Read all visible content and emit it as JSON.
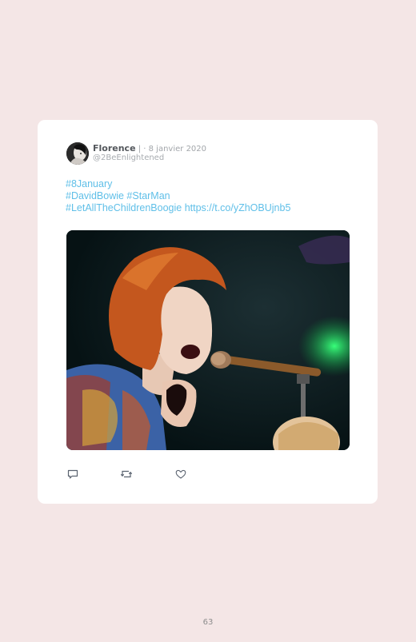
{
  "tweet": {
    "author_name": "Florence",
    "author_separator": " | ",
    "date": "· 8 janvier 2020",
    "handle": "@2BeEnlightened",
    "text_lines": [
      "#8January",
      "#DavidBowie #StarMan",
      "#LetAllTheChildrenBoogie https://t.co/yZhOBUjnb5"
    ],
    "media_icon": "video-still-singer-microphone"
  },
  "actions": [
    {
      "name": "reply",
      "icon": "speech-bubble-icon"
    },
    {
      "name": "retweet",
      "icon": "retweet-arrows-icon"
    },
    {
      "name": "like",
      "icon": "heart-icon"
    }
  ],
  "footer": {
    "page_number": "63"
  },
  "colors": {
    "page_background": "#f4e6e6",
    "card_background": "#ffffff",
    "link": "#5fbfe8",
    "name": "#53575c",
    "muted": "#a2a6aa",
    "icon": "#5b6370"
  }
}
